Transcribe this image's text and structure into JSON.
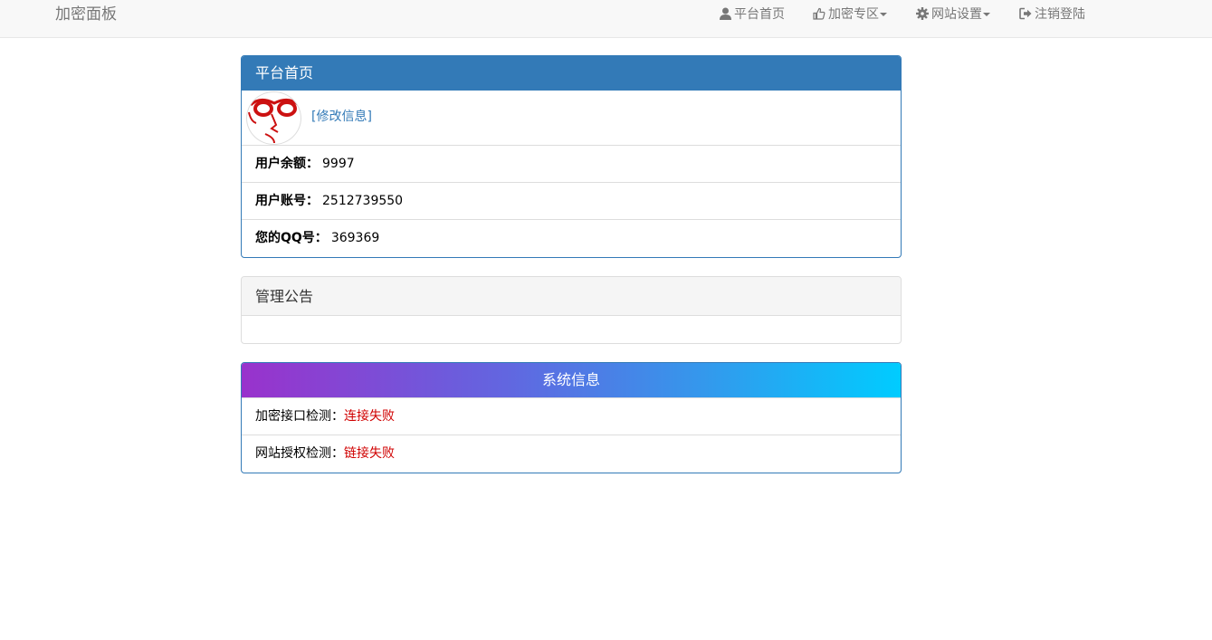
{
  "navbar": {
    "brand": "加密面板",
    "items": [
      {
        "label": "平台首页",
        "icon": "user-icon"
      },
      {
        "label": "加密专区",
        "icon": "thumbs-up-icon",
        "dropdown": true
      },
      {
        "label": "网站设置",
        "icon": "gear-icon",
        "dropdown": true
      },
      {
        "label": "注销登陆",
        "icon": "logout-icon"
      }
    ]
  },
  "home_panel": {
    "title": "平台首页",
    "edit_link": "[修改信息]",
    "rows": [
      {
        "label": "用户余额：",
        "value": "9997"
      },
      {
        "label": "用户账号：",
        "value": "2512739550"
      },
      {
        "label": "您的QQ号：",
        "value": "369369"
      }
    ]
  },
  "notice_panel": {
    "title": "管理公告",
    "body": ""
  },
  "system_panel": {
    "title": "系统信息",
    "rows": [
      {
        "label": "加密接口检测：",
        "status": "连接失败"
      },
      {
        "label": "网站授权检测：",
        "status": "链接失败"
      }
    ]
  },
  "colors": {
    "primary": "#337ab7",
    "error": "#d00000",
    "gradient_start": "#9932cc",
    "gradient_end": "#00ccff"
  }
}
